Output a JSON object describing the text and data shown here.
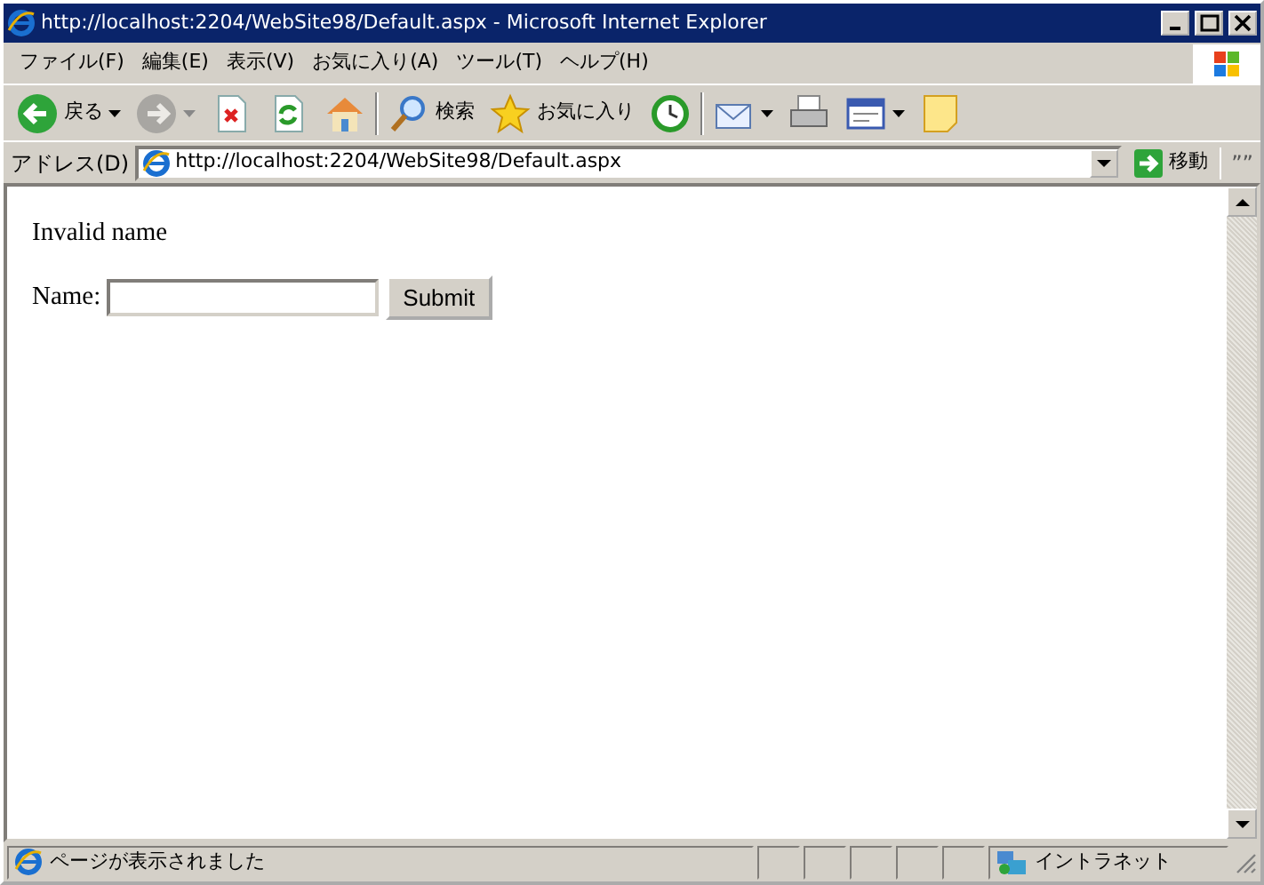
{
  "window": {
    "title": "http://localhost:2204/WebSite98/Default.aspx - Microsoft Internet Explorer"
  },
  "menu": [
    "ファイル(F)",
    "編集(E)",
    "表示(V)",
    "お気に入り(A)",
    "ツール(T)",
    "ヘルプ(H)"
  ],
  "toolbar": [
    {
      "kind": "back",
      "label": "戻る",
      "dropdown": true,
      "disabled": false
    },
    {
      "kind": "forward",
      "dropdown": true,
      "disabled": true
    },
    {
      "kind": "stop",
      "dropdown": false,
      "disabled": false
    },
    {
      "kind": "refresh",
      "dropdown": false,
      "disabled": false
    },
    {
      "kind": "home",
      "dropdown": false,
      "disabled": false
    },
    {
      "kind": "search",
      "label": "検索",
      "dropdown": false,
      "disabled": false
    },
    {
      "kind": "favorites",
      "label": "お気に入り",
      "dropdown": false,
      "disabled": false
    },
    {
      "kind": "history",
      "dropdown": false,
      "disabled": false
    },
    {
      "kind": "mail",
      "dropdown": true,
      "disabled": false
    },
    {
      "kind": "print",
      "dropdown": false,
      "disabled": false
    },
    {
      "kind": "edit",
      "dropdown": true,
      "disabled": false
    },
    {
      "kind": "note",
      "dropdown": false,
      "disabled": false
    }
  ],
  "address_bar": {
    "label": "アドレス(D)",
    "url": "http://localhost:2204/WebSite98/Default.aspx",
    "go_label": "移動",
    "links": "””"
  },
  "page": {
    "message": "Invalid name",
    "field_label": "Name:",
    "button": "Submit"
  },
  "status_bar": {
    "text": "ページが表示されました",
    "zone": "イントラネット"
  }
}
